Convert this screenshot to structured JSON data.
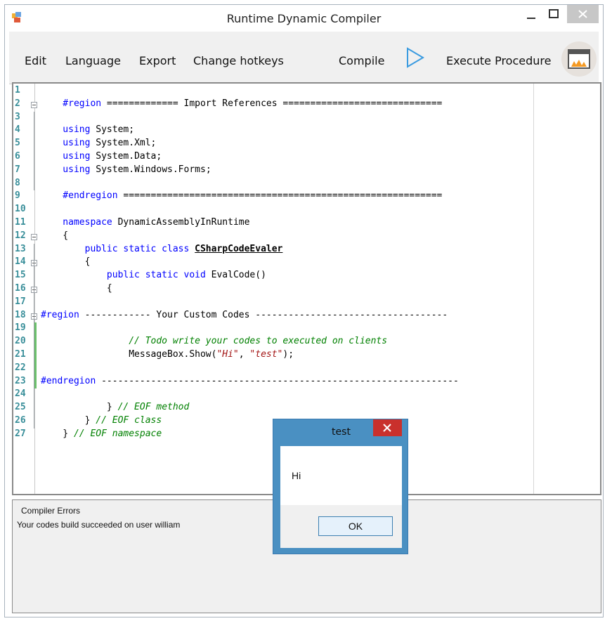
{
  "window": {
    "title": "Runtime Dynamic Compiler"
  },
  "menu": {
    "edit": "Edit",
    "language": "Language",
    "export": "Export",
    "hotkeys": "Change hotkeys",
    "compile": "Compile",
    "execute": "Execute Procedure"
  },
  "editor": {
    "line_numbers": [
      "1",
      "2",
      "3",
      "4",
      "5",
      "6",
      "7",
      "8",
      "9",
      "10",
      "11",
      "12",
      "13",
      "14",
      "15",
      "16",
      "17",
      "18",
      "19",
      "20",
      "21",
      "22",
      "23",
      "24",
      "25",
      "26",
      "27"
    ],
    "lines": [
      {
        "ln": 1,
        "segs": []
      },
      {
        "ln": 2,
        "segs": [
          {
            "k": "kw",
            "t": "    #region "
          },
          {
            "k": "tx",
            "t": "============= Import References ============================="
          }
        ]
      },
      {
        "ln": 3,
        "segs": []
      },
      {
        "ln": 4,
        "segs": [
          {
            "k": "kw",
            "t": "    using "
          },
          {
            "k": "tx",
            "t": "System;"
          }
        ]
      },
      {
        "ln": 5,
        "segs": [
          {
            "k": "kw",
            "t": "    using "
          },
          {
            "k": "tx",
            "t": "System.Xml;"
          }
        ]
      },
      {
        "ln": 6,
        "segs": [
          {
            "k": "kw",
            "t": "    using "
          },
          {
            "k": "tx",
            "t": "System.Data;"
          }
        ]
      },
      {
        "ln": 7,
        "segs": [
          {
            "k": "kw",
            "t": "    using "
          },
          {
            "k": "tx",
            "t": "System.Windows.Forms;"
          }
        ]
      },
      {
        "ln": 8,
        "segs": []
      },
      {
        "ln": 9,
        "segs": [
          {
            "k": "kw",
            "t": "    #endregion "
          },
          {
            "k": "tx",
            "t": "=========================================================="
          }
        ]
      },
      {
        "ln": 10,
        "segs": []
      },
      {
        "ln": 11,
        "segs": [
          {
            "k": "kw",
            "t": "    namespace "
          },
          {
            "k": "tx",
            "t": "DynamicAssemblyInRuntime"
          }
        ]
      },
      {
        "ln": 12,
        "segs": [
          {
            "k": "tx",
            "t": "    {"
          }
        ]
      },
      {
        "ln": 13,
        "segs": [
          {
            "k": "kw",
            "t": "        public static class "
          },
          {
            "k": "cls",
            "t": "CSharpCodeEvaler"
          }
        ]
      },
      {
        "ln": 14,
        "segs": [
          {
            "k": "tx",
            "t": "        {"
          }
        ]
      },
      {
        "ln": 15,
        "segs": [
          {
            "k": "kw",
            "t": "            public static void "
          },
          {
            "k": "tx",
            "t": "EvalCode()"
          }
        ]
      },
      {
        "ln": 16,
        "segs": [
          {
            "k": "tx",
            "t": "            {"
          }
        ]
      },
      {
        "ln": 17,
        "segs": []
      },
      {
        "ln": 18,
        "segs": [
          {
            "k": "kw",
            "t": "#region "
          },
          {
            "k": "tx",
            "t": "------------ Your Custom Codes -----------------------------------"
          }
        ]
      },
      {
        "ln": 19,
        "segs": []
      },
      {
        "ln": 20,
        "segs": [
          {
            "k": "cm",
            "t": "                // Todo write your codes to executed on clients"
          }
        ]
      },
      {
        "ln": 21,
        "segs": [
          {
            "k": "tx",
            "t": "                MessageBox.Show("
          },
          {
            "k": "str",
            "t": "\"Hi\""
          },
          {
            "k": "tx",
            "t": ", "
          },
          {
            "k": "str",
            "t": "\"test\""
          },
          {
            "k": "tx",
            "t": ");"
          }
        ]
      },
      {
        "ln": 22,
        "segs": []
      },
      {
        "ln": 23,
        "segs": [
          {
            "k": "kw",
            "t": "#endregion "
          },
          {
            "k": "tx",
            "t": "-----------------------------------------------------------------"
          }
        ]
      },
      {
        "ln": 24,
        "segs": []
      },
      {
        "ln": 25,
        "segs": [
          {
            "k": "tx",
            "t": "            } "
          },
          {
            "k": "cm",
            "t": "// EOF method"
          }
        ]
      },
      {
        "ln": 26,
        "segs": [
          {
            "k": "tx",
            "t": "        } "
          },
          {
            "k": "cm",
            "t": "// EOF class"
          }
        ]
      },
      {
        "ln": 27,
        "segs": [
          {
            "k": "tx",
            "t": "    } "
          },
          {
            "k": "cm",
            "t": "// EOF namespace"
          }
        ]
      }
    ]
  },
  "errors": {
    "legend": "Compiler Errors",
    "message": "Your codes build succeeded on user william"
  },
  "dialog": {
    "title": "test",
    "message": "Hi",
    "ok": "OK"
  },
  "colors": {
    "keyword": "#0000ff",
    "comment": "#008000",
    "string": "#a31515",
    "line_number": "#3a8f9a",
    "dialog_frame": "#4a90c2",
    "dialog_close": "#c9302c"
  }
}
